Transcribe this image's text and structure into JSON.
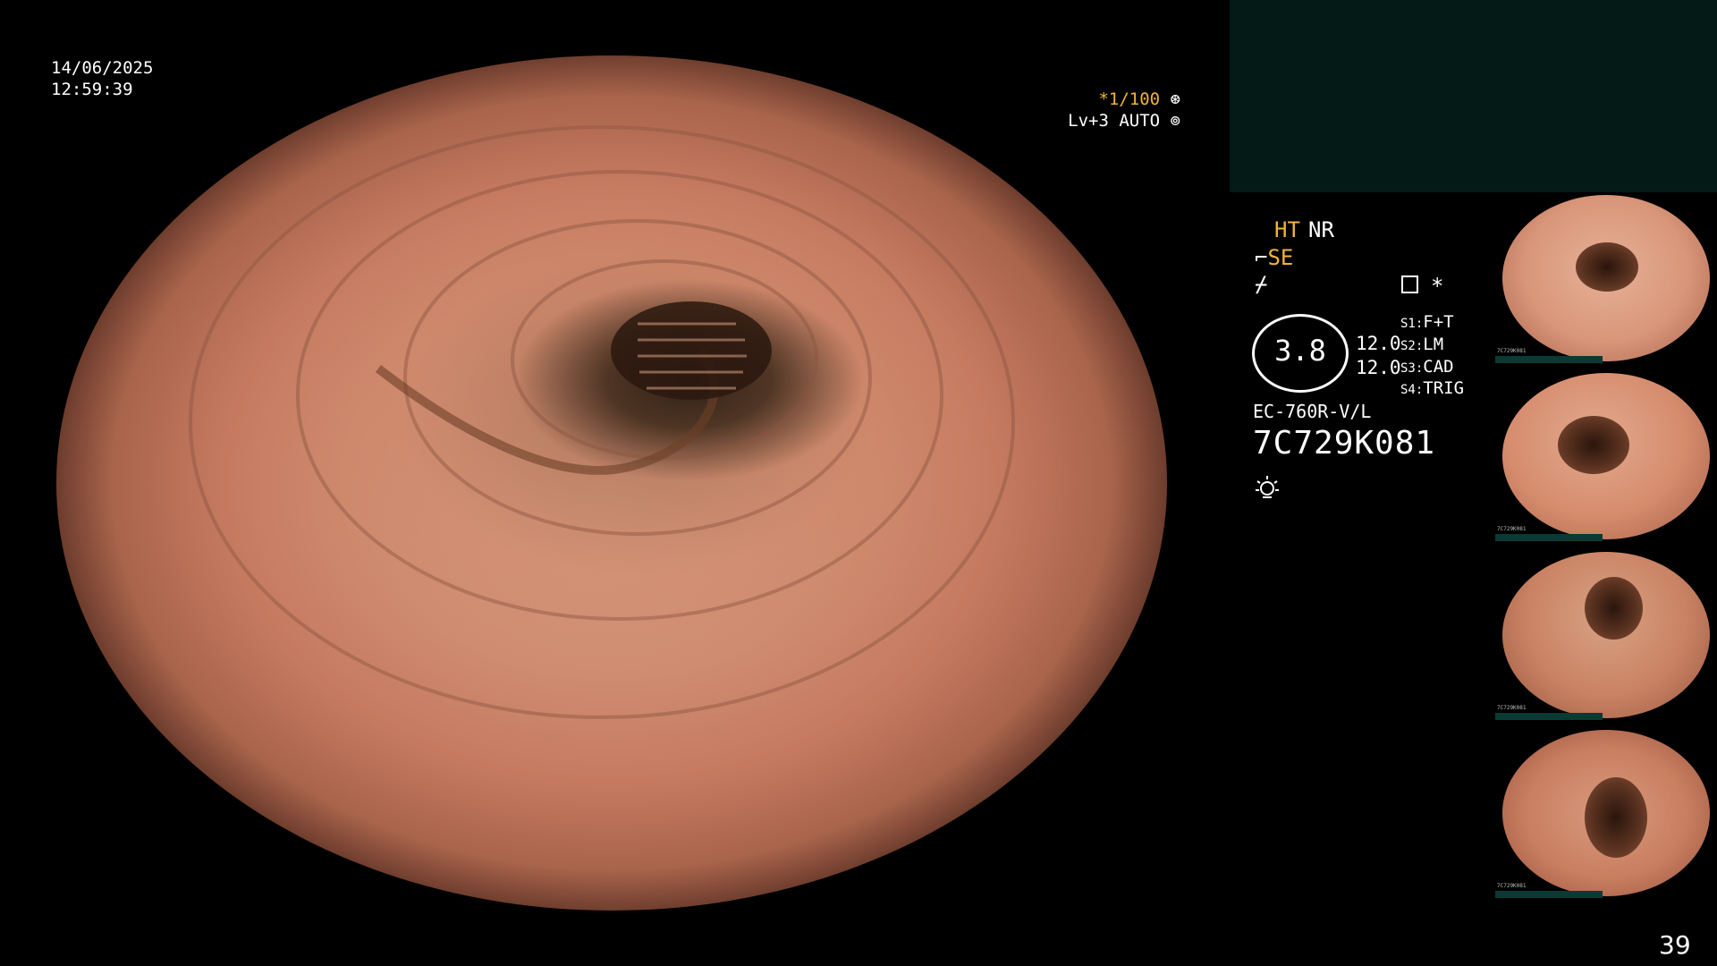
{
  "osd": {
    "date": "14/06/2025",
    "time": "12:59:39",
    "shutter": "*1/100",
    "level": "Lv+3 AUTO"
  },
  "panel": {
    "ht": "HT",
    "nr": "NR",
    "se": "SE",
    "gauge_value": "3.8",
    "value_a": "12.0",
    "value_b": "12.0",
    "switches": [
      {
        "key": "S1:",
        "value": "F+T"
      },
      {
        "key": "S2:",
        "value": "LM"
      },
      {
        "key": "S3:",
        "value": "CAD"
      },
      {
        "key": "S4:",
        "value": "TRIG"
      }
    ],
    "model": "EC-760R-V/L",
    "serial": "7C729K081"
  },
  "thumbnails": [
    {
      "label": "7C729K081"
    },
    {
      "label": "7C729K081"
    },
    {
      "label": "7C729K081"
    },
    {
      "label": "7C729K081"
    }
  ],
  "page_number": "39",
  "icons": {
    "shutter": "aperture-icon",
    "auto": "iris-icon",
    "se_mark": "scope-tip-icon",
    "enhance": "enhancement-icon",
    "doc": "document-icon",
    "star": "asterisk-icon",
    "light": "light-bulb-icon"
  },
  "colors": {
    "accent": "#f0b43a",
    "panel_bg": "#031a17"
  }
}
